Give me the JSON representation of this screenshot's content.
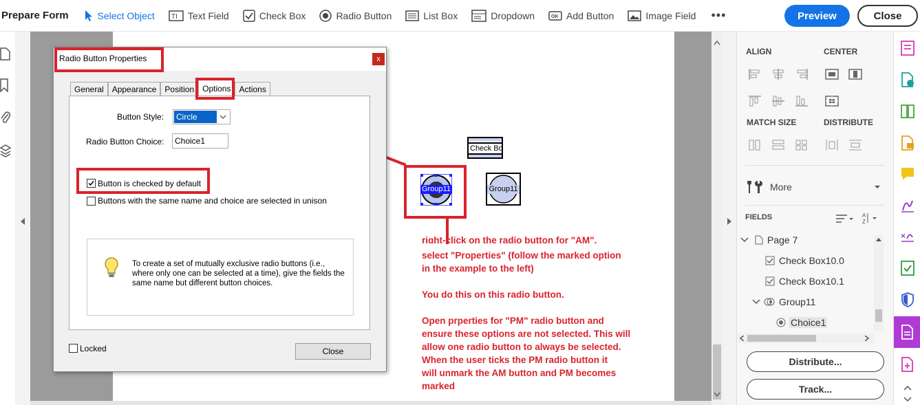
{
  "toolbar": {
    "title": "Prepare Form",
    "items": [
      {
        "label": "Select Object",
        "icon": "cursor-arrow-icon",
        "active": true
      },
      {
        "label": "Text Field",
        "icon": "text-field-icon"
      },
      {
        "label": "Check Box",
        "icon": "check-box-icon"
      },
      {
        "label": "Radio Button",
        "icon": "radio-button-icon"
      },
      {
        "label": "List Box",
        "icon": "list-box-icon"
      },
      {
        "label": "Dropdown",
        "icon": "dropdown-icon"
      },
      {
        "label": "Add Button",
        "icon": "ok-button-icon"
      },
      {
        "label": "Image Field",
        "icon": "image-field-icon"
      }
    ],
    "more": "•••",
    "preview": "Preview",
    "close": "Close"
  },
  "dialog": {
    "title": "Radio Button Properties",
    "close_glyph": "x",
    "tabs": [
      "General",
      "Appearance",
      "Position",
      "Options",
      "Actions"
    ],
    "selected_tab": "Options",
    "button_style_label": "Button Style:",
    "button_style_value": "Circle",
    "choice_label": "Radio Button Choice:",
    "choice_value": "Choice1",
    "checked_default_label": "Button is checked by default",
    "checked_default": true,
    "unison_label": "Buttons with the same name and choice are selected in unison",
    "unison": false,
    "tip": "To create a set of mutually exclusive radio buttons (i.e., where only one can be selected at a time), give the fields the same name but different button choices.",
    "locked_label": "Locked",
    "close_label": "Close"
  },
  "canvas": {
    "checkbox_field_label": "Check Bo",
    "radio1_label": "Group11",
    "radio2_label": "Group11"
  },
  "annotation": {
    "line1": "right-click on the radio button for \"AM\",",
    "line2": "select \"Properties\" (follow the marked option",
    "line3": "in the example to the left)",
    "line4": "You do this on this radio button.",
    "line5": "Open prperties for  \"PM\" radio button and",
    "line6": "ensure these options are not selected. This will",
    "line7": "allow one radio button to always be selected.",
    "line8": "When the user ticks the PM radio button it",
    "line9": "will unmark the AM button and PM becomes",
    "line10": "marked"
  },
  "right_panel": {
    "align": "ALIGN",
    "center": "CENTER",
    "match_size": "MATCH SIZE",
    "distribute": "DISTRIBUTE",
    "more": "More",
    "fields": "FIELDS",
    "tree": [
      {
        "label": "Page 7",
        "icon": "page-icon"
      },
      {
        "label": "Check Box10.0",
        "icon": "checkbox-icon"
      },
      {
        "label": "Check Box10.1",
        "icon": "checkbox-icon"
      },
      {
        "label": "Group11",
        "icon": "radio-group-icon"
      },
      {
        "label": "Choice1",
        "icon": "radio-icon"
      }
    ],
    "distribute_btn": "Distribute...",
    "track_btn": "Track..."
  },
  "colors": {
    "accent": "#1473e6",
    "annotation_red": "#d9232d",
    "right_rail_active": "#b03ad4"
  }
}
